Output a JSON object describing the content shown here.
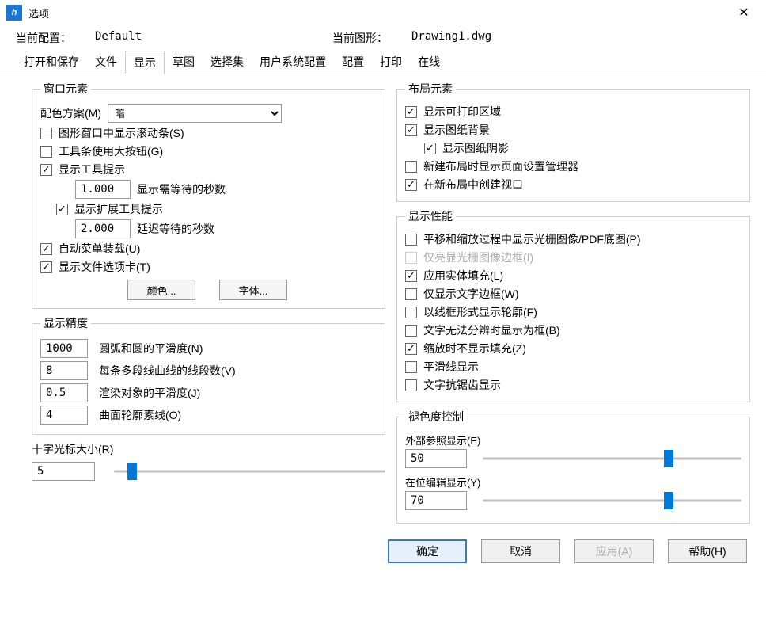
{
  "window": {
    "title": "选项"
  },
  "header": {
    "config_label": "当前配置：",
    "config_value": "Default",
    "drawing_label": "当前图形：",
    "drawing_value": "Drawing1.dwg"
  },
  "tabs": [
    "打开和保存",
    "文件",
    "显示",
    "草图",
    "选择集",
    "用户系统配置",
    "配置",
    "打印",
    "在线"
  ],
  "active_tab": 2,
  "window_elements": {
    "legend": "窗口元素",
    "color_scheme_label": "配色方案(M)",
    "color_scheme_value": "暗",
    "scrollbars": "图形窗口中显示滚动条(S)",
    "big_buttons": "工具条使用大按钮(G)",
    "tooltips": "显示工具提示",
    "tooltip_delay_value": "1.000",
    "tooltip_delay_label": "显示需等待的秒数",
    "ext_tooltips": "显示扩展工具提示",
    "ext_delay_value": "2.000",
    "ext_delay_label": "延迟等待的秒数",
    "auto_menu": "自动菜单装载(U)",
    "file_tabs": "显示文件选项卡(T)",
    "btn_colors": "颜色...",
    "btn_fonts": "字体..."
  },
  "precision": {
    "legend": "显示精度",
    "arc_value": "1000",
    "arc_label": "圆弧和圆的平滑度(N)",
    "poly_value": "8",
    "poly_label": "每条多段线曲线的线段数(V)",
    "render_value": "0.5",
    "render_label": "渲染对象的平滑度(J)",
    "surface_value": "4",
    "surface_label": "曲面轮廓素线(O)"
  },
  "crosshair": {
    "label": "十字光标大小(R)",
    "value": "5",
    "percent": 5
  },
  "layout": {
    "legend": "布局元素",
    "printable": "显示可打印区域",
    "paper_bg": "显示图纸背景",
    "paper_shadow": "显示图纸阴影",
    "page_setup": "新建布局时显示页面设置管理器",
    "viewport": "在新布局中创建视口"
  },
  "performance": {
    "legend": "显示性能",
    "raster": "平移和缩放过程中显示光栅图像/PDF底图(P)",
    "raster_frame": "仅亮显光栅图像边框(I)",
    "solid_fill": "应用实体填充(L)",
    "text_frame": "仅显示文字边框(W)",
    "sil": "以线框形式显示轮廓(F)",
    "text_box": "文字无法分辨时显示为框(B)",
    "no_fill_zoom": "缩放时不显示填充(Z)",
    "smooth_line": "平滑线显示",
    "text_aa": "文字抗锯齿显示"
  },
  "fade": {
    "legend": "褪色度控制",
    "xref_label": "外部参照显示(E)",
    "xref_value": "50",
    "xref_percent": 70,
    "inplace_label": "在位编辑显示(Y)",
    "inplace_value": "70",
    "inplace_percent": 70
  },
  "footer": {
    "ok": "确定",
    "cancel": "取消",
    "apply": "应用(A)",
    "help": "帮助(H)"
  }
}
